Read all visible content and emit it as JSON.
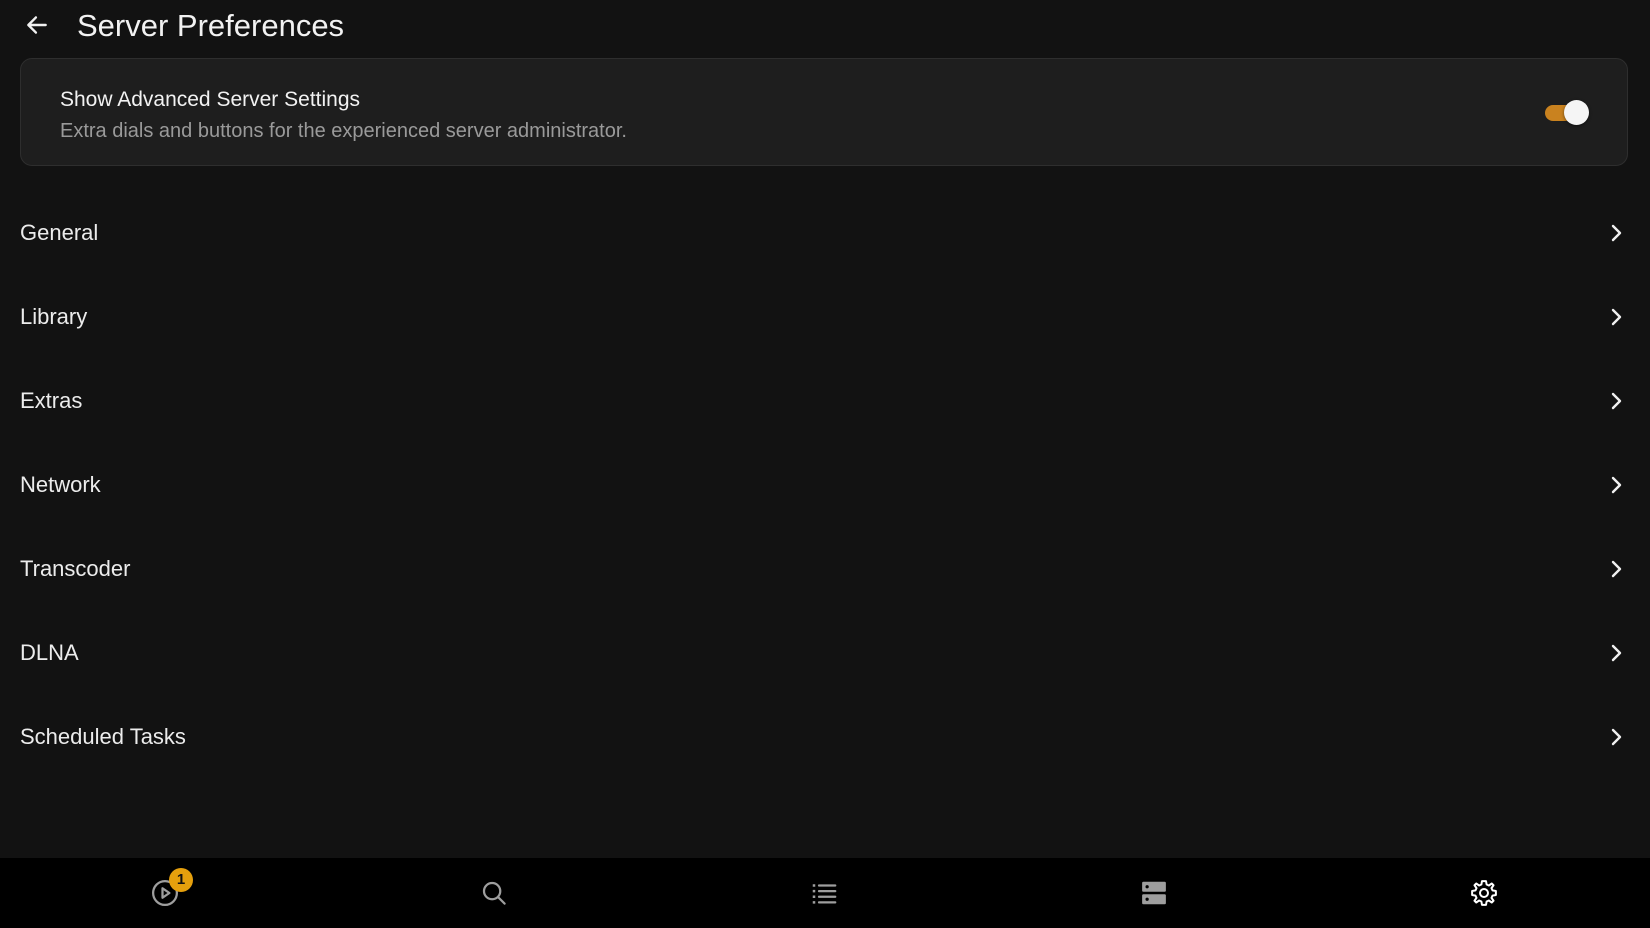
{
  "colors": {
    "background": "#121212",
    "card": "#1e1e1e",
    "accent": "#e5a00d",
    "toggle_track": "#c9821f",
    "bottom_nav": "#000000"
  },
  "header": {
    "back_icon": "arrow-left-icon",
    "title": "Server Preferences"
  },
  "advanced": {
    "title": "Show Advanced Server Settings",
    "description": "Extra dials and buttons for the experienced server administrator.",
    "enabled": true
  },
  "menu": {
    "items": [
      {
        "label": "General"
      },
      {
        "label": "Library"
      },
      {
        "label": "Extras"
      },
      {
        "label": "Network"
      },
      {
        "label": "Transcoder"
      },
      {
        "label": "DLNA"
      },
      {
        "label": "Scheduled Tasks"
      }
    ],
    "chevron_icon": "chevron-right-icon"
  },
  "bottom_nav": {
    "items": [
      {
        "icon": "play-circle-icon",
        "badge": "1"
      },
      {
        "icon": "search-icon"
      },
      {
        "icon": "list-icon"
      },
      {
        "icon": "server-icon"
      },
      {
        "icon": "gear-icon",
        "active": true
      }
    ]
  }
}
